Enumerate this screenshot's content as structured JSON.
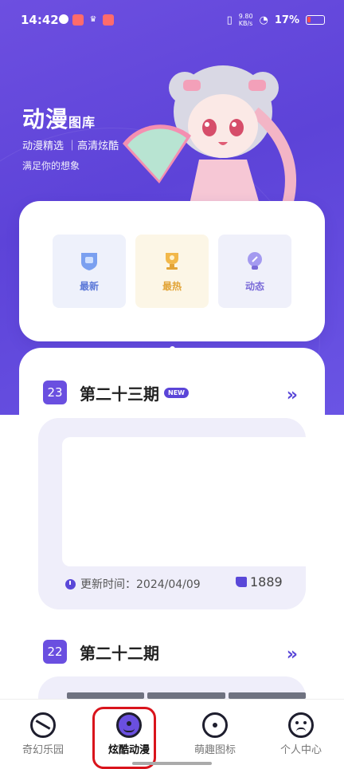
{
  "status_bar": {
    "time": "14:42",
    "network_speed": "9.80\nKB/s",
    "battery": "17%"
  },
  "header": {
    "title": "动漫",
    "title_small": "图库",
    "subtitle": "动漫精选 ｜高清炫酷",
    "tagline": "满足你的想象"
  },
  "categories": [
    {
      "label": "最新",
      "icon": "shield-icon",
      "color": "#5b78d8"
    },
    {
      "label": "最热",
      "icon": "trophy-icon",
      "color": "#e2a437"
    },
    {
      "label": "动态",
      "icon": "bulb-icon",
      "color": "#7a6bd8"
    }
  ],
  "issues": [
    {
      "number": "23",
      "title": "第二十三期",
      "badge": "NEW",
      "update_label": "更新时间：2024/04/09",
      "likes": "1889"
    },
    {
      "number": "22",
      "title": "第二十二期"
    }
  ],
  "tabs": [
    {
      "label": "奇幻乐园",
      "icon": "planet-icon"
    },
    {
      "label": "炫酷动漫",
      "icon": "face-icon",
      "active": true
    },
    {
      "label": "萌趣图标",
      "icon": "circle-dot-icon"
    },
    {
      "label": "个人中心",
      "icon": "user-icon"
    }
  ],
  "colors": {
    "accent": "#6a4fe0",
    "highlight": "#d9141c"
  }
}
